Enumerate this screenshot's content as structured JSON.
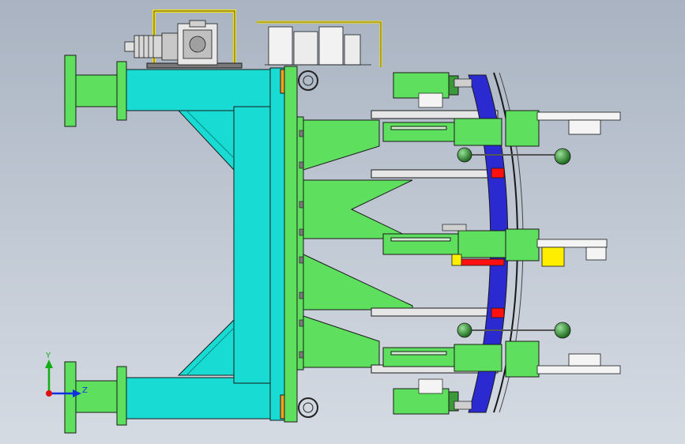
{
  "axis_triad": {
    "y_label": "Y",
    "z_label": "Z",
    "x_color": "#e01010",
    "y_color": "#10b010",
    "z_color": "#1030e0"
  },
  "colors": {
    "frame": "#18dcd4",
    "fixture_green": "#5ee05e",
    "clamp_blue": "#2a2ad0",
    "locator_red": "#ff1010",
    "locator_yellow": "#ffee00",
    "bracket_gray": "#e6e6e6",
    "hook_yellow": "#f0e020",
    "outline": "#1a1a1a"
  }
}
